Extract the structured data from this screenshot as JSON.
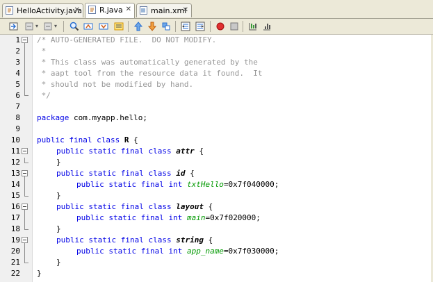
{
  "tabs": [
    {
      "label": "HelloActivity.java",
      "icon": "java-file-icon",
      "active": false
    },
    {
      "label": "R.java",
      "icon": "java-file-icon",
      "active": true
    },
    {
      "label": "main.xml",
      "icon": "xml-file-icon",
      "active": false
    }
  ],
  "toolbar": {
    "buttons": [
      "last-edit-icon",
      "back-icon",
      "forward-icon",
      "find-selection-icon",
      "find-previous-icon",
      "find-next-icon",
      "toggle-highlight-icon",
      "previous-bookmark-icon",
      "next-bookmark-icon",
      "toggle-bookmark-icon",
      "shift-left-icon",
      "shift-right-icon",
      "start-macro-icon",
      "stop-macro-icon",
      "comment-icon",
      "uncomment-icon"
    ]
  },
  "line_numbers": [
    "1",
    "2",
    "3",
    "4",
    "5",
    "6",
    "7",
    "8",
    "9",
    "10",
    "11",
    "12",
    "13",
    "14",
    "15",
    "16",
    "17",
    "18",
    "19",
    "20",
    "21",
    "22"
  ],
  "code": {
    "l1": "/* AUTO-GENERATED FILE.  DO NOT MODIFY.",
    "l2": " *",
    "l3": " * This class was automatically generated by the",
    "l4": " * aapt tool from the resource data it found.  It",
    "l5": " * should not be modified by hand.",
    "l6": " */",
    "l8_kw": "package",
    "l8_rest": " com.myapp.hello;",
    "l10_kw": "public final class",
    "l10_name": "R",
    "l10_rest": " {",
    "l11_kw": "public static final class",
    "l11_name": "attr",
    "l11_rest": " {",
    "l12": "}",
    "l13_kw": "public static final class",
    "l13_name": "id",
    "l13_rest": " {",
    "l14_kw": "public static final int",
    "l14_field": "txtHello",
    "l14_rest": "=0x7f040000;",
    "l15": "}",
    "l16_kw": "public static final class",
    "l16_name": "layout",
    "l16_rest": " {",
    "l17_kw": "public static final int",
    "l17_field": "main",
    "l17_rest": "=0x7f020000;",
    "l18": "}",
    "l19_kw": "public static final class",
    "l19_name": "string",
    "l19_rest": " {",
    "l20_kw": "public static final int",
    "l20_field": "app_name",
    "l20_rest": "=0x7f030000;",
    "l21": "}",
    "l22": "}"
  }
}
